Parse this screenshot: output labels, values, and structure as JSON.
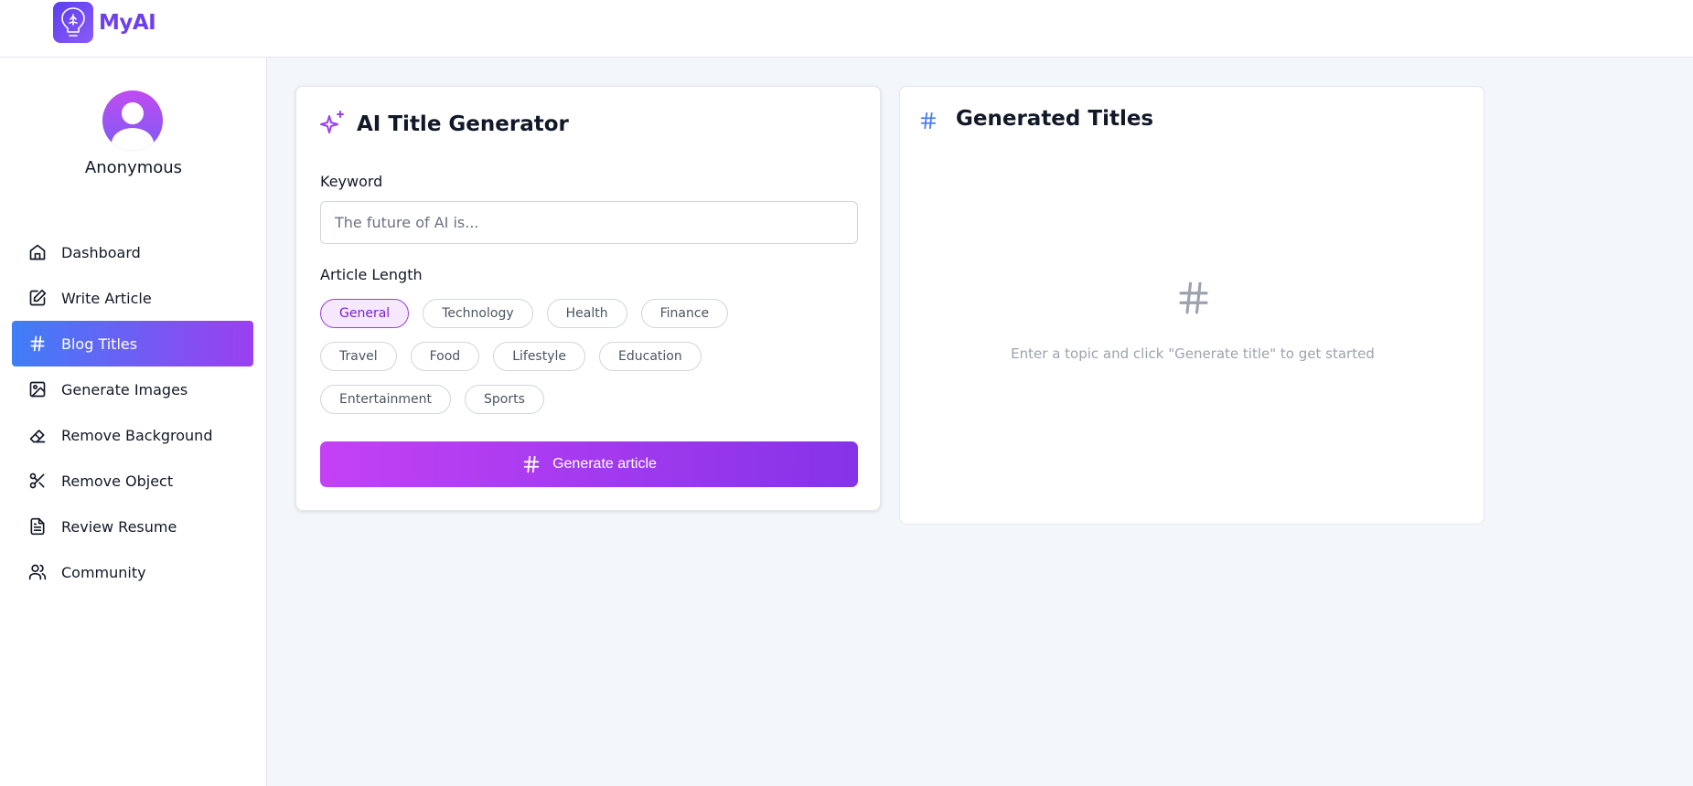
{
  "app": {
    "name": "MyAI"
  },
  "user": {
    "name": "Anonymous"
  },
  "sidebar": {
    "items": [
      {
        "label": "Dashboard",
        "icon": "home-icon"
      },
      {
        "label": "Write Article",
        "icon": "edit-icon"
      },
      {
        "label": "Blog Titles",
        "icon": "hash-icon",
        "active": true
      },
      {
        "label": "Generate Images",
        "icon": "image-icon"
      },
      {
        "label": "Remove Background",
        "icon": "eraser-icon"
      },
      {
        "label": "Remove Object",
        "icon": "scissors-icon"
      },
      {
        "label": "Review Resume",
        "icon": "file-text-icon"
      },
      {
        "label": "Community",
        "icon": "users-icon"
      }
    ]
  },
  "generator": {
    "title": "AI Title Generator",
    "keyword_label": "Keyword",
    "keyword_value": "",
    "keyword_placeholder": "The future of AI is...",
    "length_label": "Article Length",
    "categories": [
      "General",
      "Technology",
      "Health",
      "Finance",
      "Travel",
      "Food",
      "Lifestyle",
      "Education",
      "Entertainment",
      "Sports"
    ],
    "selected_category": "General",
    "button_label": "Generate article"
  },
  "results": {
    "title": "Generated Titles",
    "empty_message": "Enter a topic and click \"Generate title\" to get started"
  },
  "colors": {
    "accent": "#6d3ff0",
    "active_gradient_start": "#3f7ef7",
    "active_gradient_end": "#9b3ff0",
    "button_gradient_start": "#c441f5",
    "button_gradient_end": "#8533e8",
    "hash_blue": "#4a7cf2"
  }
}
